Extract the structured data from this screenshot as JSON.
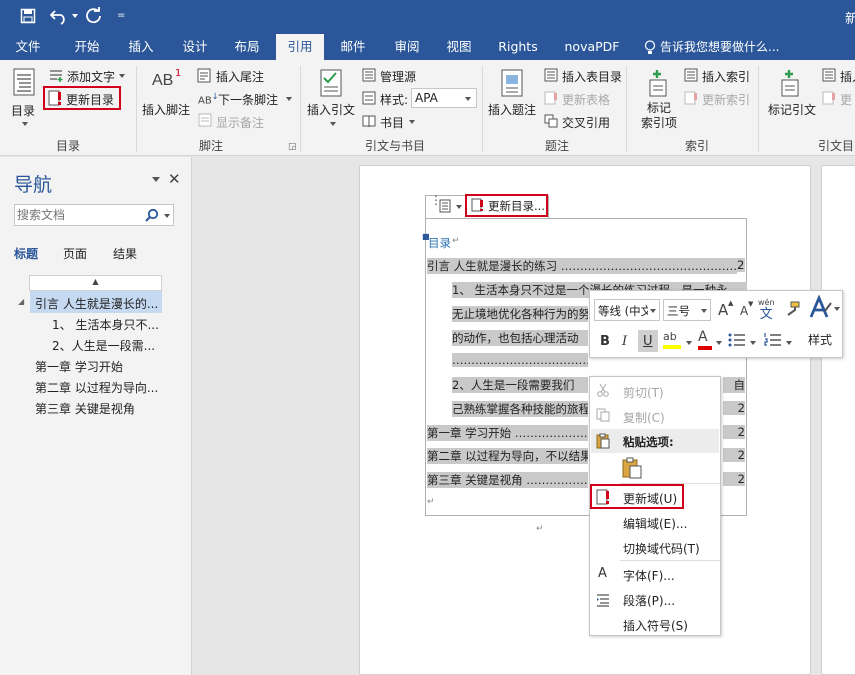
{
  "window": {
    "title_partial": "新"
  },
  "tabs": [
    {
      "label": "文件"
    },
    {
      "label": "开始"
    },
    {
      "label": "插入"
    },
    {
      "label": "设计"
    },
    {
      "label": "布局"
    },
    {
      "label": "引用"
    },
    {
      "label": "邮件"
    },
    {
      "label": "审阅"
    },
    {
      "label": "视图"
    },
    {
      "label": "Rights"
    },
    {
      "label": "novaPDF"
    }
  ],
  "tell_me": "告诉我您想要做什么...",
  "ribbon": {
    "toc": {
      "toc_label": "目录",
      "add_text": "添加文字",
      "update_toc": "更新目录",
      "group": "目录"
    },
    "footnotes": {
      "insert_footnote": "插入脚注",
      "ab_glyph": "AB",
      "sup_glyph": "1",
      "insert_endnote": "插入尾注",
      "next_footnote": "下一条脚注",
      "show_notes": "显示备注",
      "group": "脚注"
    },
    "citations": {
      "insert_citation": "插入引文",
      "manage_sources": "管理源",
      "style_label": "样式:",
      "style_value": "APA",
      "bibliography": "书目",
      "group": "引文与书目"
    },
    "captions": {
      "insert_caption": "插入题注",
      "insert_table_of_figures": "插入表目录",
      "update_table": "更新表格",
      "cross_reference": "交叉引用",
      "group": "题注"
    },
    "index": {
      "mark_entry": "标记\n索引项",
      "insert_index": "插入索引",
      "update_index": "更新索引",
      "group": "索引"
    },
    "authorities": {
      "mark_citation": "标记引文",
      "insert_partial": "插入",
      "update_partial": "更",
      "group": "引文目"
    }
  },
  "nav": {
    "title": "导航",
    "search_placeholder": "搜索文档",
    "tabs": [
      "标题",
      "页面",
      "结果"
    ],
    "headings": [
      "引言 人生就是漫长的...",
      "1、 生活本身只不...",
      "2、人生是一段需...",
      "第一章 学习开始",
      "第二章 以过程为导向...",
      "第三章 关键是视角"
    ]
  },
  "doc": {
    "update_toc_button": "更新目录...",
    "toc_title": "目录",
    "lines": [
      {
        "text": "引言  人生就是漫长的练习 ……………………………………………………………………2",
        "indent": 0
      },
      {
        "text": "1、 生活本身只不过是一个漫长的练习过程，是一种永",
        "indent": 1
      },
      {
        "text": "无止境地优化各种行为的努力",
        "indent": 1
      },
      {
        "text": "的动作，也包括心理活动",
        "indent": 1
      },
      {
        "text": "……………………………………………………………………………………",
        "indent": 1
      },
      {
        "text": "2、人生是一段需要我们",
        "indent": 1
      },
      {
        "text": "己熟练掌握各种技能的旅程",
        "indent": 1
      },
      {
        "text": "第一章  学习开始 ……………………………………………",
        "indent": 0
      },
      {
        "text": "第二章  以过程为导向，不以结果",
        "indent": 0
      },
      {
        "text": "第三章  关键是视角 ……………………………………………",
        "indent": 0
      }
    ],
    "rights": [
      "2",
      "自",
      "2",
      "2",
      "2",
      "2"
    ]
  },
  "mini": {
    "font": "等线 (中文",
    "size": "三号",
    "styles": "样式",
    "wen": "wén",
    "wen_char": "文",
    "font_grow": "A",
    "font_shrink": "A",
    "bold": "B",
    "italic": "I",
    "underline": "U",
    "font_color": "A",
    "ab_mark": "ab"
  },
  "context": {
    "cut": "剪切(T)",
    "copy": "复制(C)",
    "paste_options": "粘贴选项:",
    "update_field": "更新域(U)",
    "edit_field": "编辑域(E)...",
    "toggle_codes": "切换域代码(T)",
    "font": "字体(F)...",
    "paragraph": "段落(P)...",
    "insert_symbol": "插入符号(S)",
    "font_glyph": "A"
  },
  "colors": {
    "brand": "#2b579a",
    "highlight_red": "#d0021b",
    "selection": "#c9c9c9"
  }
}
